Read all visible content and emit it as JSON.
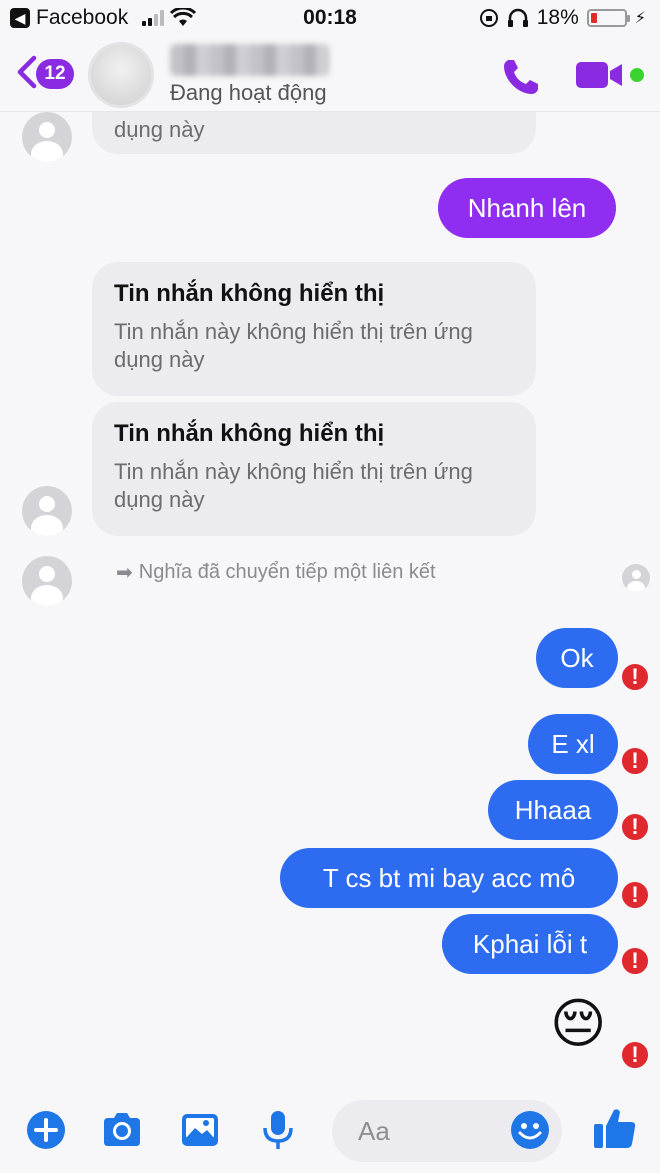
{
  "status_bar": {
    "app_name": "Facebook",
    "time": "00:18",
    "battery_text": "18%",
    "battery_level": 0.18,
    "battery_color": "#e02b2b"
  },
  "header": {
    "unread_count": "12",
    "contact_status": "Đang hoạt động",
    "accent_color": "#8a2be2",
    "online_color": "#3bd32f"
  },
  "messages": {
    "top_partial_text": "dụng này",
    "nhanh_len": "Nhanh lên",
    "hidden_1": {
      "title": "Tin nhắn không hiển thị",
      "body": "Tin nhắn này không hiển thị trên ứng dụng này"
    },
    "hidden_2": {
      "title": "Tin nhắn không hiển thị",
      "body": "Tin nhắn này không hiển thị trên ứng dụng này"
    },
    "forwarded_notice": "Nghĩa đã chuyển tiếp một liên kết",
    "sent": [
      "Ok",
      "E xl",
      "Hhaaa",
      "T cs bt mi bay acc mô",
      "Kphai lỗi t"
    ],
    "emoji": "😔",
    "error_mark": "!",
    "sent_color": "#2d6bf0",
    "purple_color": "#8f2ef0"
  },
  "composer": {
    "placeholder": "Aa",
    "icons": [
      "plus-icon",
      "camera-icon",
      "image-icon",
      "microphone-icon",
      "emoji-icon",
      "thumbs-up-icon"
    ],
    "icon_color": "#1f76e6"
  }
}
